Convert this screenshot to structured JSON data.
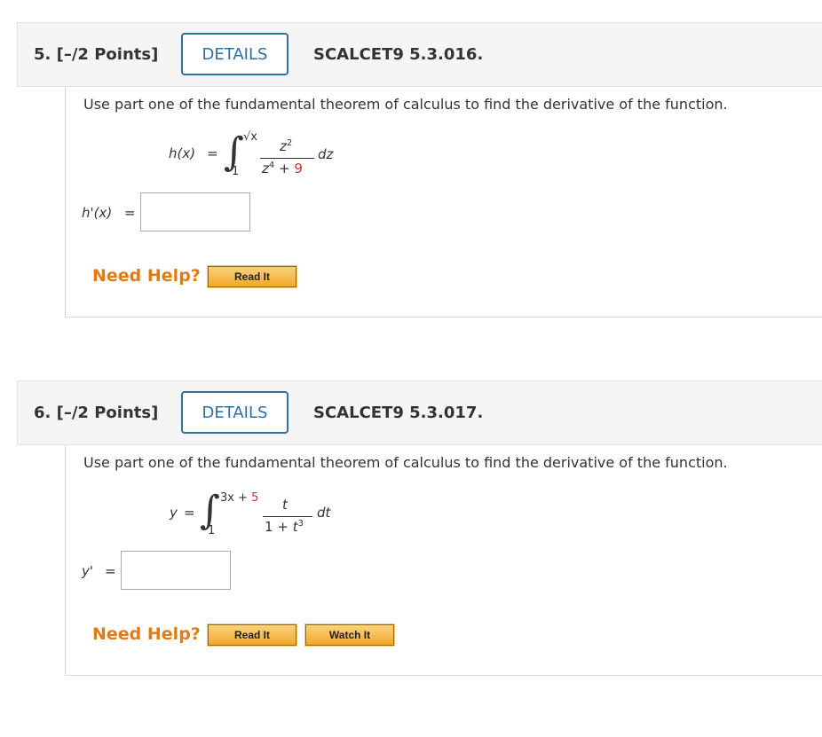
{
  "q5": {
    "number": "5. [–/2 Points]",
    "details": "DETAILS",
    "code": "SCALCET9 5.3.016.",
    "prompt": "Use part one of the fundamental theorem of calculus to find the derivative of the function.",
    "func_lhs": "h(x)",
    "equals": "=",
    "upper": "√x",
    "lower": "1",
    "num": "z",
    "num_exp": "2",
    "den_var": "z",
    "den_exp": "4",
    "den_plus": "+",
    "den_const": "9",
    "differential": "dz",
    "answer_label": "h'(x)",
    "answer_eq": "=",
    "answer_value": "",
    "need_help": "Need Help?",
    "read_it": "Read It"
  },
  "q6": {
    "number": "6. [–/2 Points]",
    "details": "DETAILS",
    "code": "SCALCET9 5.3.017.",
    "prompt": "Use part one of the fundamental theorem of calculus to find the derivative of the function.",
    "func_lhs": "y",
    "equals": "=",
    "upper_a": "3x",
    "upper_plus": "+",
    "upper_b": "5",
    "lower": "1",
    "num": "t",
    "den_a": "1",
    "den_plus": "+",
    "den_var": "t",
    "den_exp": "3",
    "differential": "dt",
    "answer_label": "y'",
    "answer_eq": "=",
    "answer_value": "",
    "need_help": "Need Help?",
    "read_it": "Read It",
    "watch_it": "Watch It"
  },
  "colors": {
    "accent_blue": "#2f6f9e",
    "help_orange": "#e07b16",
    "red_number": "#c0392b",
    "header_bg": "#f5f5f5"
  }
}
